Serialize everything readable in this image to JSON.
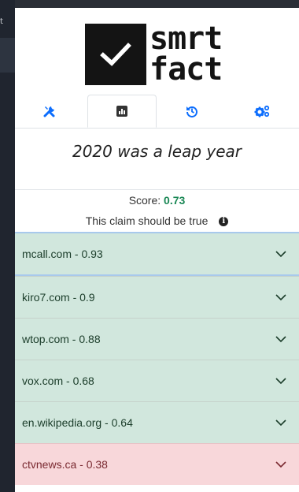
{
  "background": {
    "edge_text": "t"
  },
  "logo": {
    "line1": "smrt",
    "line2": "fact"
  },
  "tabs": [
    {
      "name": "tools",
      "icon": "tools-icon"
    },
    {
      "name": "results",
      "icon": "chart-icon",
      "active": true
    },
    {
      "name": "history",
      "icon": "history-icon"
    },
    {
      "name": "settings",
      "icon": "gears-icon"
    }
  ],
  "claim": "2020 was a leap year",
  "score": {
    "label": "Score:",
    "value": "0.73"
  },
  "verdict": "This claim should be true",
  "sources": [
    {
      "label": "mcall.com - 0.93",
      "status": "green"
    },
    {
      "label": "kiro7.com - 0.9",
      "status": "green"
    },
    {
      "label": "wtop.com - 0.88",
      "status": "green"
    },
    {
      "label": "vox.com - 0.68",
      "status": "green"
    },
    {
      "label": "en.wikipedia.org - 0.64",
      "status": "green"
    },
    {
      "label": "ctvnews.ca - 0.38",
      "status": "red"
    }
  ],
  "colors": {
    "tab_accent": "#0d6efd",
    "score_good": "#198754",
    "row_green": "#d1e7dd",
    "row_red": "#f8d7da"
  }
}
